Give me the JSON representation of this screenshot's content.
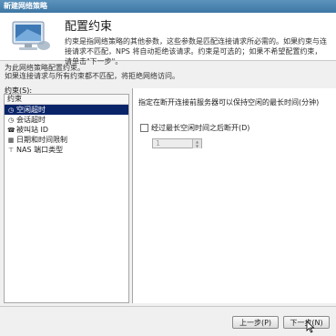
{
  "window": {
    "title": "新建网络策略"
  },
  "header": {
    "title": "配置约束",
    "description": "约束是指网络策略的其他参数，这些参数是匹配连接请求所必需的。如果约束与连接请求不匹配，NPS 将自动拒绝该请求。约束是可选的；如果不希望配置约束，请单击\"下一步\"。"
  },
  "intro": {
    "line1": "为此网络策略配置约束。",
    "line2": "如果连接请求与所有约束都不匹配，将拒绝网络访问。"
  },
  "constraints": {
    "label": "约束(S):",
    "list_header": "约束",
    "items": [
      {
        "label": "空闲超时",
        "icon": "clock-icon"
      },
      {
        "label": "会话超时",
        "icon": "clock-icon"
      },
      {
        "label": "被叫站 ID",
        "icon": "phone-icon"
      },
      {
        "label": "日期和时间限制",
        "icon": "calendar-icon"
      },
      {
        "label": "NAS 端口类型",
        "icon": "network-icon"
      }
    ],
    "selected_index": 0
  },
  "detail": {
    "description": "指定在断开连接前服务器可以保持空闲的最长时间(分钟)",
    "checkbox_label": "经过最长空闲时间之后断开(D)",
    "checkbox_checked": false,
    "spinner_value": "1"
  },
  "footer": {
    "prev_label": "上一步(P)",
    "next_label": "下一步(N)"
  }
}
